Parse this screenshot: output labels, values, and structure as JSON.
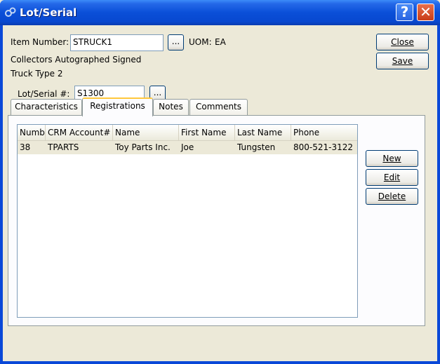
{
  "window": {
    "title": "Lot/Serial",
    "help_label": "?",
    "close_label": "✕"
  },
  "item": {
    "number_label": "Item Number:",
    "number_value": "STRUCK1",
    "uom_label": "UOM:",
    "uom_value": "EA",
    "description_1": "Collectors Autographed Signed",
    "description_2": "Truck Type 2"
  },
  "lot": {
    "label": "Lot/Serial #:",
    "value": "S1300"
  },
  "lookup_label": "...",
  "actions": {
    "close_label": "Close",
    "save_label": "Save"
  },
  "tabs": [
    {
      "label": "Characteristics"
    },
    {
      "label": "Registrations"
    },
    {
      "label": "Notes"
    },
    {
      "label": "Comments"
    }
  ],
  "registrations": {
    "columns": [
      "Numb",
      "CRM Account#",
      "Name",
      "First Name",
      "Last Name",
      "Phone"
    ],
    "rows": [
      [
        "38",
        "TPARTS",
        "Toy Parts Inc.",
        "Joe",
        "Tungsten",
        "800-521-3122"
      ]
    ],
    "new_label": "New",
    "edit_label": "Edit",
    "delete_label": "Delete"
  },
  "colors": {
    "titlebar": "#0a4fd8",
    "face": "#ece9d8",
    "active_tab_accent": "#ffc83c"
  }
}
